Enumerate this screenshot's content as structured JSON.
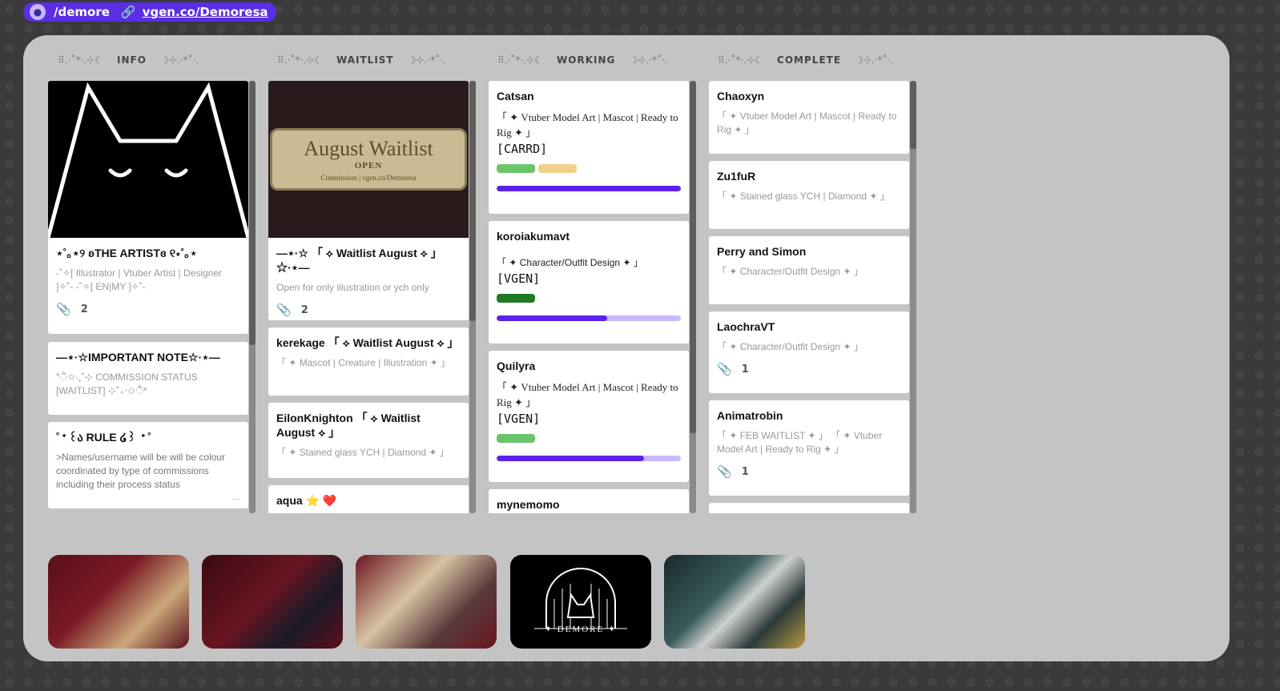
{
  "top": {
    "handle": "/demore",
    "site": "vgen.co/Demoresa"
  },
  "columns": [
    {
      "heading_left": "⠿.·˚*·.⊹☾",
      "heading": "INFO",
      "heading_right": "☽⊹.·*˚·.",
      "cards": [
        {
          "title": "⋆˚｡⋆୨ ʚTHE ARTISTɞ ୧⋆˚｡⋆",
          "desc": "‐˚✧[ Illustrator | Vtuber Artist | Designer ]✧˚‐ ‐˚✧[ EN|MY ]✧˚‐",
          "attachments": "2"
        },
        {
          "title": "—⋆·☆IMPORTANT NOTE☆·⋆—",
          "desc": "*ੈ✩‧₊˚⊹ COMMISSION STATUS [WAITLIST] ⊹˚₊‧✩ੈ*"
        },
        {
          "title": "˚‧꒰ა RULE ໒꒱ ‧˚",
          "desc": ">Names/username will be will be colour coordinated by type of commissions including their process status",
          "more": "..."
        }
      ]
    },
    {
      "heading_left": "⠿.·˚*·.⊹☾",
      "heading": "WAITLIST",
      "heading_right": "☽⊹.·*˚·.",
      "cover": {
        "title": "August Waitlist",
        "status": "OPEN",
        "sub": "Commission | vgen.co/Demoresa"
      },
      "cards": [
        {
          "title": "—⋆·☆ 「 ⟡ Waitlist August ⟡ 」☆·⋆—",
          "desc": "Open for only illustration or ych only",
          "attachments": "2"
        },
        {
          "title": "kerekage 「 ⟡ Waitlist August ⟡ 」",
          "desc": "「 ✦ Mascot | Creature | Illustration ✦ 」"
        },
        {
          "title": "EilonKnighton 「 ⟡ Waitlist August ⟡ 」",
          "desc": "「 ✦ Stained glass YCH | Diamond ✦ 」"
        },
        {
          "title": "aqua ⭐ ❤️"
        }
      ]
    },
    {
      "heading_left": "⠿.·˚*·.⊹☾",
      "heading": "WORKING",
      "heading_right": "☽⊹.·*˚·.",
      "cards": [
        {
          "title": "Catsan",
          "desc": "「 ✦ Vtuber Model Art | Mascot | Ready to Rig ✦ 」",
          "tag": "[CARRD]",
          "labels": [
            "#6cc46a",
            "#f1d08c"
          ],
          "progress": 1.0
        },
        {
          "title": "koroiakumavt",
          "desc": "「 ✦ Character/Outfit Design ✦ 」",
          "tag": "[VGEN]",
          "labels": [
            "#1e7a23"
          ],
          "progress": 0.6
        },
        {
          "title": "Quilyra",
          "desc": "「 ✦ Vtuber Model Art | Mascot | Ready to Rig ✦ 」",
          "tag": "[VGEN]",
          "labels": [
            "#6cc46a"
          ],
          "progress": 0.8
        },
        {
          "title": "mynemomo"
        }
      ]
    },
    {
      "heading_left": "⠿.·˚*·.⊹☾",
      "heading": "COMPLETE",
      "heading_right": "☽⊹.·*˚·.",
      "cards": [
        {
          "title": "Chaoxyn",
          "desc": "「 ✦ Vtuber Model Art | Mascot | Ready to Rig ✦ 」"
        },
        {
          "title": "Zu1fuR",
          "desc": "「 ✦ Stained glass YCH | Diamond ✦ 」"
        },
        {
          "title": "Perry and Simon",
          "desc": "「 ✦ Character/Outfit Design ✦ 」"
        },
        {
          "title": "LaochraVT",
          "desc": "「 ✦ Character/Outfit Design ✦ 」",
          "attachments": "1"
        },
        {
          "title": "Animatrobin",
          "desc": "「 ✦ FEB WAITLIST ✦ 」 「 ✦ Vtuber Model Art | Ready to Rig ✦ 」",
          "attachments": "1"
        }
      ]
    }
  ],
  "thumbnails": [
    {
      "name": "anime-illustration-commission"
    },
    {
      "name": "design-vtuber-model-commission"
    },
    {
      "name": "mascot-illustration-commission"
    },
    {
      "name": "demore-logo",
      "text": "✦ DEMORE ✦"
    },
    {
      "name": "character-artwork"
    }
  ],
  "colors": {
    "accent": "#5b22ee",
    "board": "#c4c4c4",
    "progress_track": "#c9b8ff"
  }
}
